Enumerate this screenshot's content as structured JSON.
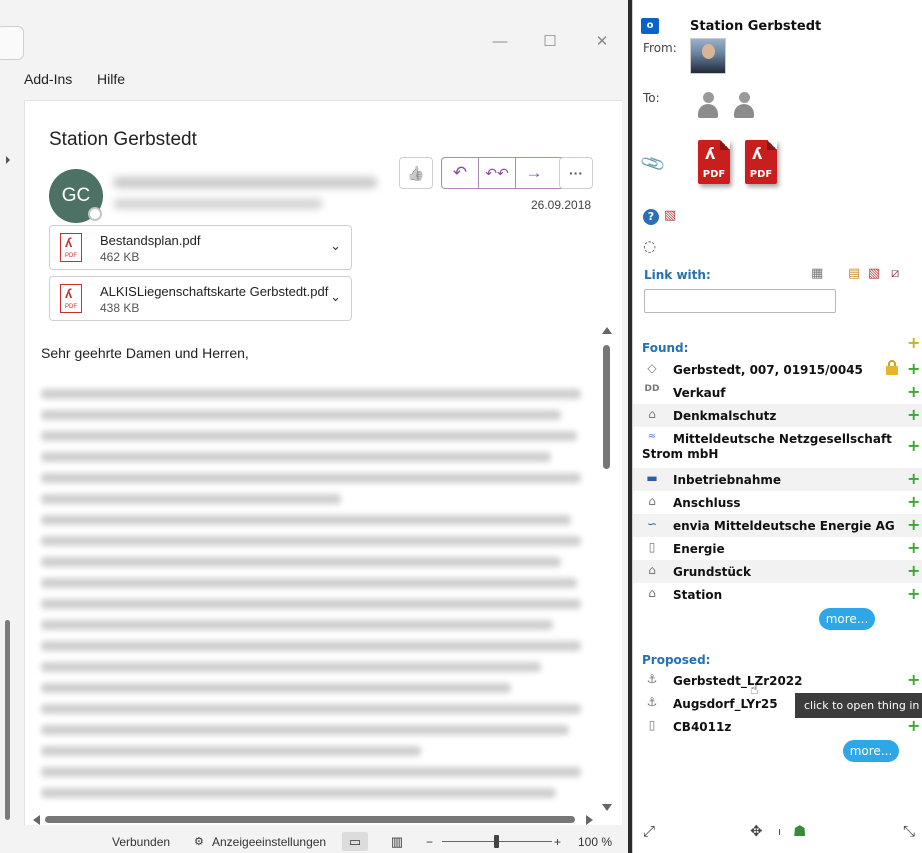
{
  "outlook": {
    "menu": [
      "Add-Ins",
      "Hilfe"
    ],
    "window_controls": {
      "minimize": "—",
      "maximize": "☐",
      "close": "✕"
    },
    "email": {
      "subject": "Station Gerbstedt",
      "sender_initials": "GC",
      "date": "26.09.2018",
      "attachments": [
        {
          "name": "Bestandsplan.pdf",
          "size": "462 KB"
        },
        {
          "name": "ALKISLiegenschaftskarte Gerbstedt.pdf",
          "size": "438 KB"
        }
      ],
      "greeting": "Sehr geehrte Damen und Herren,"
    },
    "actions": {
      "like": "👍",
      "reply": "↶",
      "reply_all": "↶↶",
      "forward": "→",
      "more": "···"
    },
    "statusbar": {
      "connection": "Verbunden",
      "display_settings": "Anzeigeeinstellungen",
      "zoom_minus": "−",
      "zoom_plus": "+",
      "zoom": "100 %",
      "zoom_level": 0.5
    }
  },
  "coview": {
    "title": "Station Gerbstedt",
    "from_label": "From:",
    "to_label": "To:",
    "attachment_icons": [
      "PDF",
      "PDF"
    ],
    "link_with_label": "Link with:",
    "found_label": "Found:",
    "found": [
      {
        "label": "Gerbstedt, 007, 01915/0045",
        "icon": "parcel-icon",
        "locked": true
      },
      {
        "label": "Verkauf",
        "icon": "dd-icon"
      },
      {
        "label": "Denkmalschutz",
        "icon": "building-icon"
      },
      {
        "label": "Mitteldeutsche Netzgesellschaft",
        "label2": "Strom mbH",
        "icon": "company-logo-icon"
      },
      {
        "label": "Inbetriebnahme",
        "icon": "tag-icon"
      },
      {
        "label": "Anschluss",
        "icon": "building-icon"
      },
      {
        "label": "envia Mitteldeutsche Energie AG",
        "icon": "company-logo-icon"
      },
      {
        "label": "Energie",
        "icon": "device-icon"
      },
      {
        "label": "Grundstück",
        "icon": "house-icon"
      },
      {
        "label": "Station",
        "icon": "house-icon"
      }
    ],
    "more_label": "more...",
    "proposed_label": "Proposed:",
    "proposed": [
      {
        "label": "Gerbstedt_LZr2022",
        "icon": "anchor-icon"
      },
      {
        "label": "Augsdorf_LYr25",
        "icon": "anchor-icon"
      },
      {
        "label": "CB4011z",
        "icon": "cabinet-icon"
      }
    ],
    "tooltip": "click to open thing in CoView",
    "plus": "+",
    "colors": {
      "link_blue": "#2471b3",
      "plus_green": "#3aa832",
      "more_button": "#2ea7e8",
      "pdf_red": "#c81e1e"
    }
  }
}
